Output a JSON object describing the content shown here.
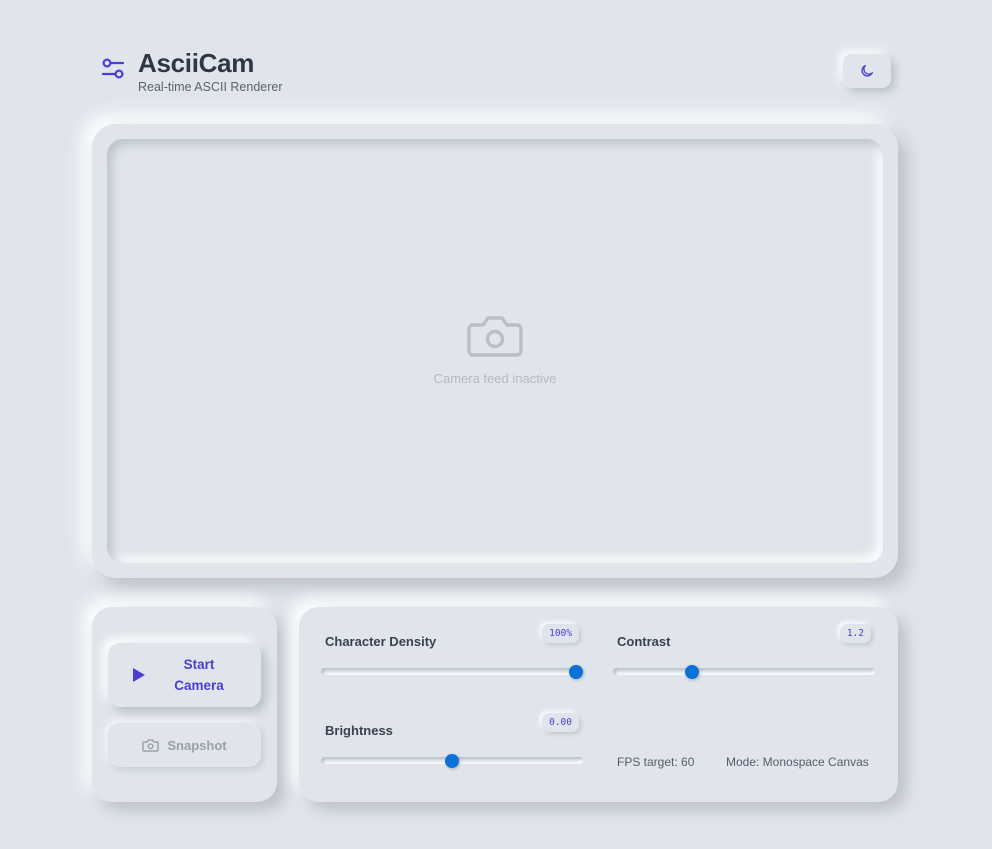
{
  "header": {
    "title": "AsciiCam",
    "subtitle": "Real-time ASCII Renderer",
    "logo_icon": "sliders-icon",
    "theme_toggle_icon": "moon-icon"
  },
  "viewer": {
    "placeholder_icon": "camera-icon",
    "status": "Camera feed inactive"
  },
  "actions": {
    "start_label": "Start Camera",
    "start_icon": "play-icon",
    "snapshot_label": "Snapshot",
    "snapshot_icon": "camera-icon"
  },
  "controls": {
    "density": {
      "label": "Character Density",
      "value": "100%",
      "fraction": 1.0
    },
    "contrast": {
      "label": "Contrast",
      "value": "1.2",
      "fraction": 0.29
    },
    "brightness": {
      "label": "Brightness",
      "value": "0.00",
      "fraction": 0.5
    }
  },
  "stats": {
    "fps": "FPS target: 60",
    "mode": "Mode: Monospace Canvas"
  },
  "colors": {
    "background": "#e0e5ec",
    "accent": "#4a3fd4",
    "slider_thumb": "#0a72d6"
  }
}
